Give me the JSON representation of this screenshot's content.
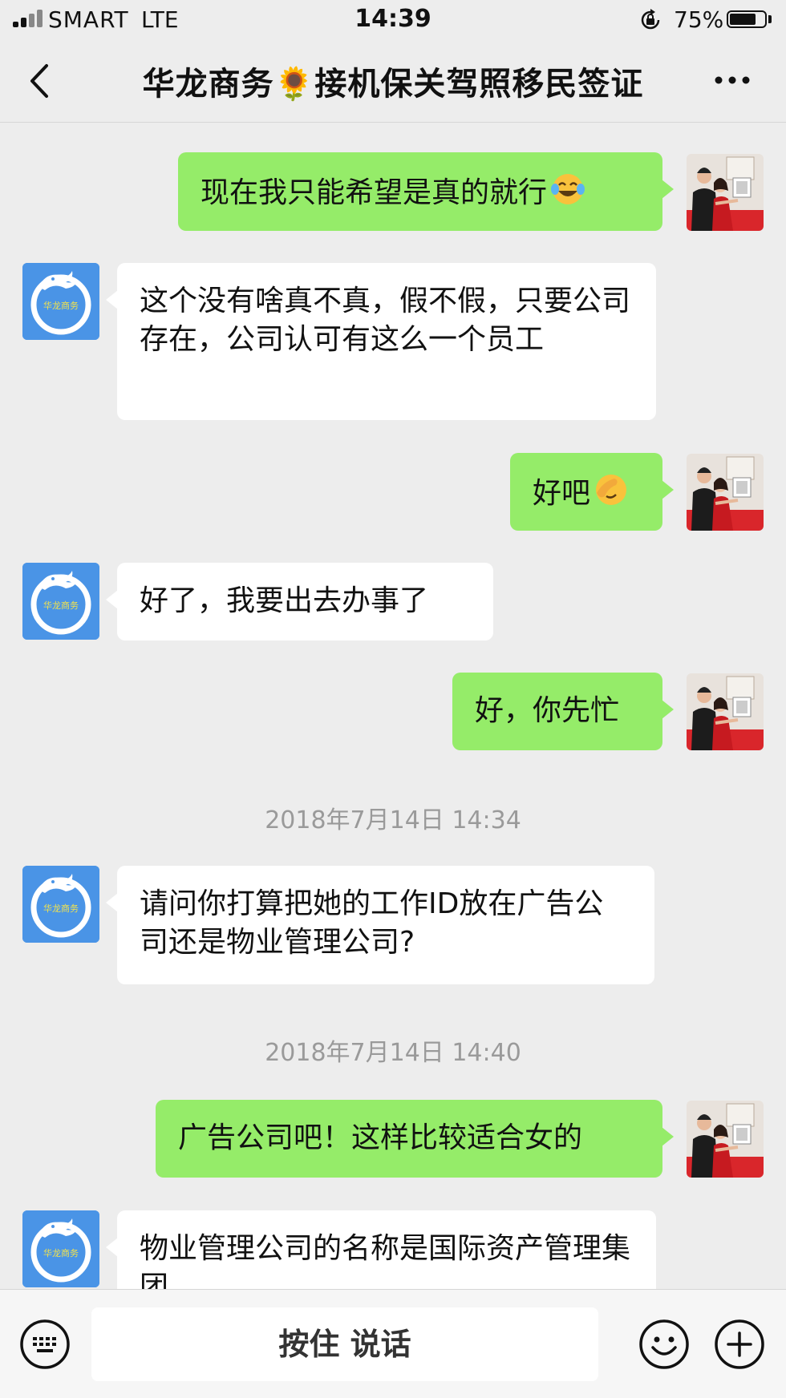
{
  "status_bar": {
    "carrier": "SMART",
    "network": "LTE",
    "time": "14:39",
    "battery_percent_text": "75%",
    "battery_level": 0.75
  },
  "nav": {
    "title": "华龙商务🌻接机保关驾照移民签证",
    "back_icon": "chevron-left-icon",
    "more_icon": "more-dots-icon"
  },
  "messages": [
    {
      "side": "out",
      "text": "现在我只能希望是真的就行",
      "emoji": "tears-of-joy"
    },
    {
      "side": "in",
      "text": "这个没有啥真不真，假不假，只要公司存在，公司认可有这么一个员工"
    },
    {
      "side": "out",
      "text": "好吧",
      "emoji": "facepalm"
    },
    {
      "side": "in",
      "text": "好了，我要出去办事了"
    },
    {
      "side": "out",
      "text": "好，你先忙"
    },
    {
      "side": "in",
      "text": "请问你打算把她的工作ID放在广告公司还是物业管理公司?"
    },
    {
      "side": "out",
      "text": "广告公司吧！这样比较适合女的"
    },
    {
      "side": "in",
      "text": "物业管理公司的名称是国际资产管理集团"
    }
  ],
  "timestamps": [
    "2018年7月14日 14:34",
    "2018年7月14日 14:40"
  ],
  "contact_avatar_text": "华龙商务",
  "input_bar": {
    "voice_label": "按住 说话",
    "keyboard_icon": "keyboard-icon",
    "emoji_icon": "smiley-icon",
    "plus_icon": "plus-circle-icon"
  },
  "colors": {
    "background": "#ededed",
    "outgoing_bubble": "#95ec69",
    "incoming_bubble": "#ffffff",
    "avatar_blue": "#4a94e6"
  }
}
